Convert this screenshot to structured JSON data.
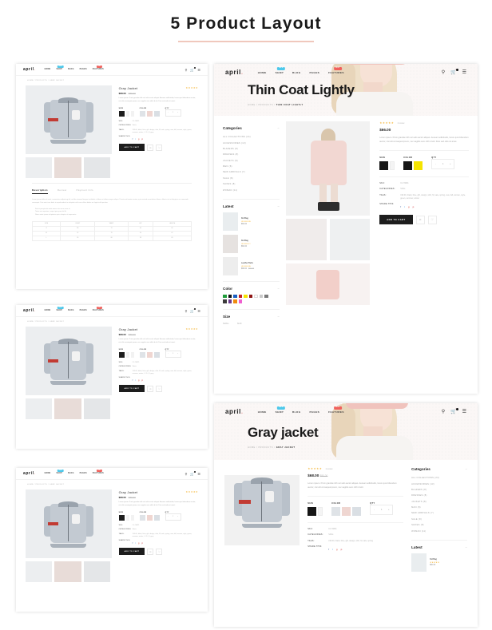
{
  "header": {
    "title": "5 Product Layout"
  },
  "brand": {
    "name": "april",
    "dot": "."
  },
  "nav": [
    {
      "label": "HOME",
      "badge": ""
    },
    {
      "label": "SHOP",
      "badge": "New",
      "badge_type": "new"
    },
    {
      "label": "BLOG",
      "badge": ""
    },
    {
      "label": "PAGES",
      "badge": ""
    },
    {
      "label": "FEATURES",
      "badge": "Hot",
      "badge_type": "hot"
    }
  ],
  "header_icons": [
    {
      "name": "search-icon",
      "glyph": "⌕"
    },
    {
      "name": "cart-icon",
      "glyph": "Ὥ2"
    },
    {
      "name": "menu-icon",
      "glyph": "☰"
    }
  ],
  "panel_a": {
    "breadcrumb": "HOME  /  PRODUCTS  /  GRAY JACKET",
    "breadcrumb_current": "GRAY JACKET",
    "product": {
      "name": "Gray Jacket",
      "stars": "★★★★★",
      "reviews": "1 review",
      "price": "$68.00",
      "old_price": "$80.00",
      "description": "Lorem ipsum. Proin gravida nibh vel velit auctor aliquet. Aenean sollicitudin, lorem quis bibendum auctor, nisi elit consequat ipsum, nec sagittis sem nibh id elit. Duis sed odio sit amet.",
      "size_label": "SIZE",
      "color_label": "COLOR",
      "qty_label": "QTY",
      "qty_value": "1",
      "sku_label": "SKU:",
      "sku_value": "CJ-70821",
      "categories_label": "CATEGORIES:",
      "categories_value": "Shirts",
      "tags_label": "TAGS:",
      "tags_value": "199.00, black, blue, gift, design, shirt, M, sale, spring, new, fall, woman, style, green, summer, winter, L, XL, S, grey",
      "share_label": "SHARE THIS:",
      "add_to_cart": "ADD TO CART"
    },
    "tabs": [
      {
        "label": "Description",
        "active": true
      },
      {
        "label": "Review",
        "active": false
      },
      {
        "label": "Payment Info",
        "active": false
      }
    ],
    "tab_body": "Lorem ipsum dolor sit amet, consectetur adipiscing elit, sed do eiusmod tempor incididunt ut labore et dolore magna aliqua. Ut enim ad minim veniam, quis nostrud exercitation ullamco laboris nisi ut aliquip ex ea commodo consequat. Duis aute irure dolor in reprehenderit in voluptate velit esse cillum dolore eu fugiat nulla pariatur.",
    "tab_bullets": [
      "Sed ut perspiciatis unde omnis iste natus error sit",
      "Totam rem aperiam, eaque ipsa quae ab illo",
      "Nemo enim ipsam voluptatem quia voluptas sit aspernatur"
    ],
    "size_table": {
      "headers": [
        "SIZE",
        "CHEST",
        "WAIST",
        "HIP",
        "LENGTH"
      ],
      "rows": [
        [
          "S",
          "88",
          "72",
          "90",
          "65"
        ],
        [
          "M",
          "92",
          "76",
          "94",
          "67"
        ],
        [
          "L",
          "96",
          "80",
          "98",
          "69"
        ]
      ]
    }
  },
  "panel_b": {
    "hero_title": "Thin Coat Lightly",
    "breadcrumb": "HOME  /  PRODUCTS  /",
    "breadcrumb_current": "THIN COAT LIGHTLY",
    "sidebar": {
      "categories_title": "Categories",
      "categories": [
        "ALL COLLECTIONS (24)",
        "ACCESSORIES (13)",
        "BLAZERS (8)",
        "DRESSES (8)",
        "JACKETS (8)",
        "MEN (8)",
        "NEW ARRIVALS (7)",
        "SALE (8)",
        "SHOES (8)",
        "WOMAN (11)"
      ],
      "latest_title": "Latest",
      "latest": [
        {
          "name": "Kid Bag",
          "stars": "★★★★★",
          "price": "$60.00",
          "old": ""
        },
        {
          "name": "Kid Bag",
          "stars": "★★★★☆",
          "price": "$60.00",
          "old": ""
        },
        {
          "name": "Leather Belts",
          "stars": "★★★★★",
          "price": "$68.00",
          "old": "$80.00"
        }
      ],
      "color_title": "Color",
      "colors": [
        "#1f9c3a",
        "#111111",
        "#1b5fc1",
        "#c42020",
        "#f5e400",
        "#8f1616",
        "#ffffff",
        "#c9c9c9",
        "#7a7a7a",
        "#3a3a3a",
        "#6b3a8f",
        "#ef8b10",
        "#ef5fd0"
      ],
      "size_title": "Size",
      "sizes": [
        "SMALL",
        "SLIM"
      ]
    },
    "detail": {
      "stars": "★★★★★",
      "reviews": "1 review",
      "price": "$66.00",
      "description": "Lorem ipsum. Proin gravida nibh vel velit auctor aliquet. Aenean sollicitudin, lorem quis bibendum auctor, nisi elit consequat ipsum, nec sagittis sem nibh id elit. Duis sed odio sit amet.",
      "size_label": "SIZE",
      "color_label": "COLOR",
      "qty_label": "QTY",
      "qty_value": "1",
      "sku_label": "SKU:",
      "sku_value": "CJ-70821",
      "categories_label": "CATEGORIES:",
      "categories_value": "Shirts",
      "tags_label": "TAGS:",
      "tags_value": "199.00, black, blue, gift, design, shirt, M, sale, spring, new, fall, woman, style, green, summer, winter",
      "share_label": "SHARE THIS:",
      "add_to_cart": "ADD TO CART"
    }
  },
  "panel_c": {
    "breadcrumb": "HOME  /  PRODUCTS  /  GRAY JACKET",
    "breadcrumb_current": "GRAY JACKET",
    "product": {
      "name": "Gray Jacket",
      "stars": "★★★★★",
      "reviews": "1 review",
      "price": "$68.00",
      "old_price": "$80.00",
      "description": "Lorem ipsum. Proin gravida nibh vel velit auctor aliquet. Aenean sollicitudin, lorem quis bibendum auctor, nisi elit consequat ipsum, nec sagittis sem nibh id elit. Duis sed odio sit amet.",
      "size_label": "SIZE",
      "color_label": "COLOR",
      "qty_label": "QTY",
      "qty_value": "1",
      "sku_label": "SKU:",
      "sku_value": "CJ-70821",
      "categories_label": "CATEGORIES:",
      "categories_value": "Shirts",
      "tags_label": "TAGS:",
      "tags_value": "199.00, black, blue, gift, design, shirt, M, sale, spring, new, fall, woman, style, green, summer, winter, L, XL, S, grey",
      "share_label": "SHARE THIS:",
      "add_to_cart": "ADD TO CART"
    }
  },
  "panel_d": {
    "breadcrumb": "HOME  /  PRODUCTS  /  GRAY JACKET",
    "breadcrumb_current": "GRAY JACKET",
    "product": {
      "name": "Gray Jacket",
      "stars": "★★★★★",
      "reviews": "1 review",
      "price": "$68.00",
      "old_price": "$80.00",
      "description": "Lorem ipsum. Proin gravida nibh vel velit auctor aliquet. Aenean sollicitudin, lorem quis bibendum auctor, nisi elit consequat ipsum, nec sagittis sem nibh id elit. Duis sed odio sit amet.",
      "size_label": "SIZE",
      "color_label": "COLOR",
      "qty_label": "QTY",
      "qty_value": "1",
      "sku_label": "SKU:",
      "sku_value": "CJ-70821",
      "categories_label": "CATEGORIES:",
      "categories_value": "Shirts",
      "tags_label": "TAGS:",
      "tags_value": "199.00, black, blue, gift, design, shirt, M, sale, spring, new, fall, woman, style, green, summer, winter, L, XL, S, grey",
      "share_label": "SHARE THIS:",
      "add_to_cart": "ADD TO CART"
    }
  },
  "panel_e": {
    "hero_title": "Gray jacket",
    "breadcrumb": "HOME  /  PRODUCTS  /",
    "breadcrumb_current": "GRAY JACKET",
    "detail": {
      "stars": "★★★★★",
      "reviews": "1 review",
      "price": "$68.00",
      "old_price": "$80.00",
      "description": "Lorem ipsum. Proin gravida nibh vel velit auctor aliquet. Aenean sollicitudin, lorem quis bibendum auctor, nisi elit consequat ipsum, nec sagittis sem nibh id elit.",
      "size_label": "SIZE",
      "color_label": "COLOR",
      "qty_label": "QTY",
      "qty_value": "1",
      "sku_label": "SKU:",
      "sku_value": "CJ-70821",
      "categories_label": "CATEGORIES:",
      "categories_value": "Shirts",
      "tags_label": "TAGS:",
      "tags_value": "199.00, black, blue, gift, design, shirt, M, sale, spring",
      "share_label": "SHARE THIS:",
      "add_to_cart": "ADD TO CART"
    },
    "sidebar": {
      "categories_title": "Categories",
      "categories": [
        "ALL COLLECTIONS (24)",
        "ACCESSORIES (13)",
        "BLAZERS (8)",
        "DRESSES (8)",
        "JACKETS (8)",
        "MAN (8)",
        "NEW ARRIVALS (7)",
        "SALE (8)",
        "SHOES (8)",
        "WOMAN (11)"
      ],
      "latest_title": "Latest",
      "latest": [
        {
          "name": "Kid Bag",
          "stars": "★★★★★",
          "price": "$60.00",
          "old": ""
        }
      ]
    }
  },
  "social_icons": [
    "f",
    "t",
    "g",
    "p"
  ],
  "colors": {
    "accent": "#f0c8bd",
    "badge_new": "#4ec8ea",
    "badge_hot": "#f0615c",
    "star": "#f5b942",
    "dark": "#1d1d1d"
  }
}
